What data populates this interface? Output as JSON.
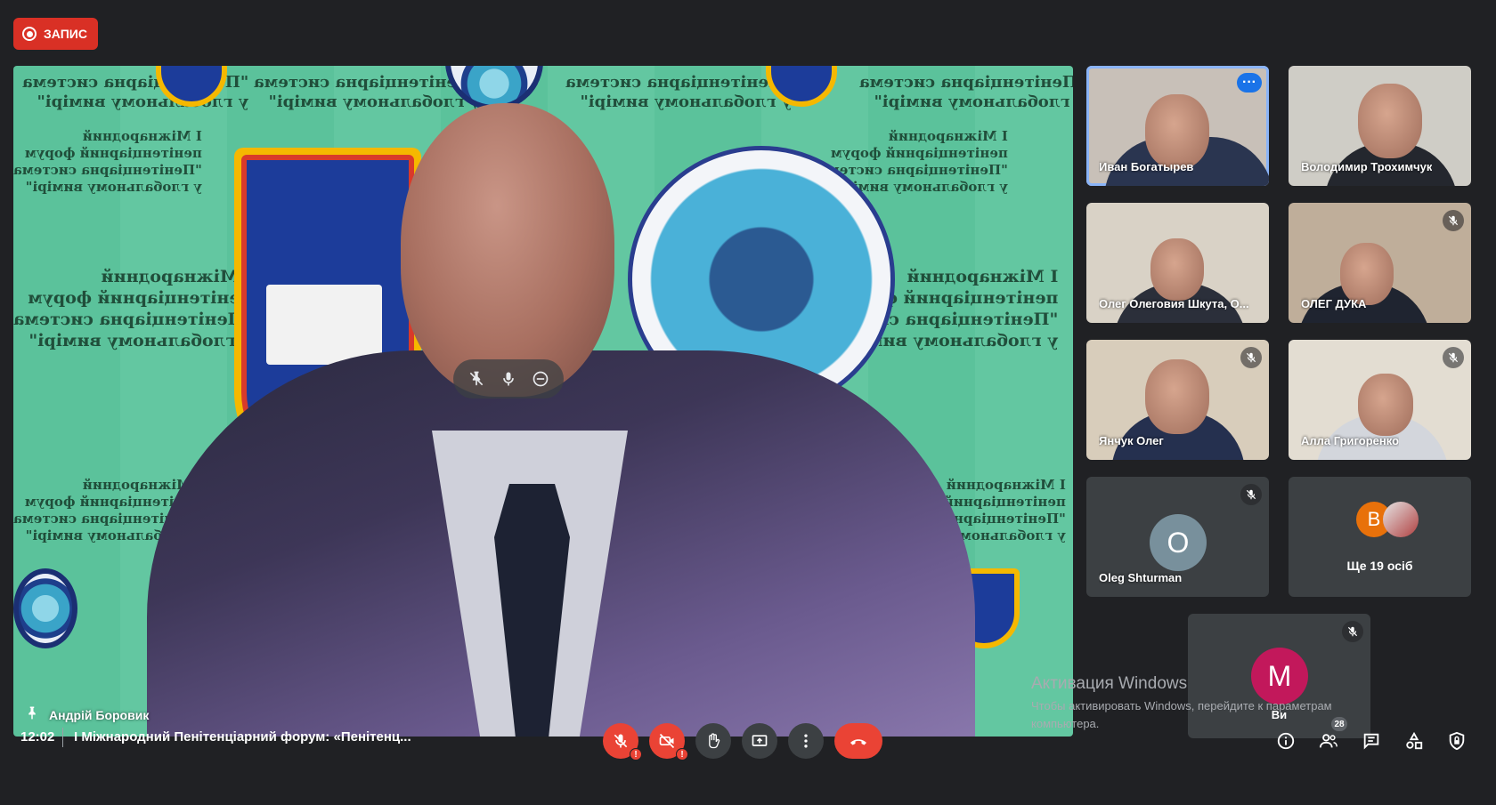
{
  "recording": {
    "label": "ЗАПИС"
  },
  "main_video": {
    "speaker_name": "Андрій Боровик",
    "background_text": [
      "I Міжнародний",
      "пенітенціарний форум",
      "\"Пенітенціарна система",
      "у глобальному вимірі\""
    ]
  },
  "participants": [
    {
      "name": "Иван Богатырев",
      "muted": false,
      "active": true
    },
    {
      "name": "Володимир Трохимчук",
      "muted": false
    },
    {
      "name": "Олег Олеговия Шкута, О...",
      "muted": false
    },
    {
      "name": "ОЛЕГ ДУКА",
      "muted": true
    },
    {
      "name": "Янчук Олег",
      "muted": true
    },
    {
      "name": "Алла Григоренко",
      "muted": true
    },
    {
      "name": "Oleg Shturman",
      "avatar_letter": "O",
      "avatar_color": "#78909c",
      "muted": true
    },
    {
      "name": "Ще 19 осіб",
      "avatar_letter": "В",
      "avatar_color": "#e8710a"
    },
    {
      "name": "Ви",
      "avatar_letter": "M",
      "avatar_color": "#c2185b",
      "muted": true
    }
  ],
  "windows_activation": {
    "title": "Активация Windows",
    "text": "Чтобы активировать Windows, перейдите к параметрам компьютера."
  },
  "bottom_bar": {
    "time": "12:02",
    "meeting_title": "I Міжнародний Пенітенціарний форум: «Пенітенц...",
    "participant_count": "28"
  },
  "colors": {
    "record": "#d93025",
    "danger": "#ea4335",
    "accent": "#8ab4f8",
    "background": "#202124"
  }
}
